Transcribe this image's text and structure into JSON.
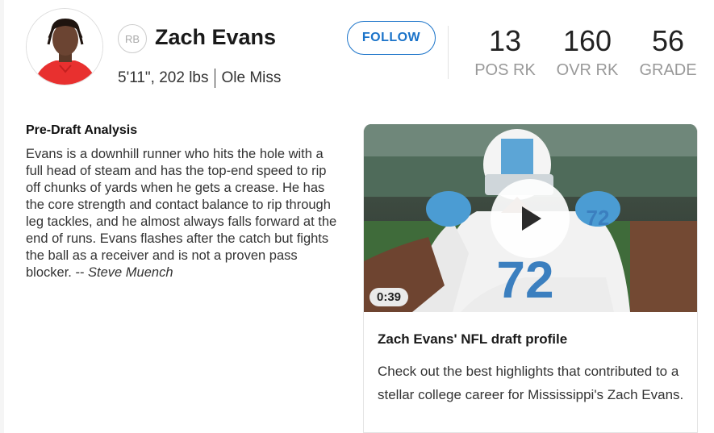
{
  "player": {
    "position": "RB",
    "name": "Zach Evans",
    "measurables": "5'11\", 202 lbs",
    "school": "Ole Miss"
  },
  "follow_label": "FOLLOW",
  "stats": [
    {
      "value": "13",
      "label": "POS RK"
    },
    {
      "value": "160",
      "label": "OVR RK"
    },
    {
      "value": "56",
      "label": "GRADE"
    }
  ],
  "analysis": {
    "title": "Pre-Draft Analysis",
    "body": "Evans is a downhill runner who hits the hole with a full head of steam and has the top-end speed to rip off chunks of yards when he gets a crease. He has the core strength and contact balance to rip through leg tackles, and he almost always falls forward at the end of runs. Evans flashes after the catch but fights the ball as a receiver and is not a proven pass blocker. -- ",
    "author": "Steve Muench"
  },
  "video": {
    "duration": "0:39",
    "title": "Zach Evans' NFL draft profile",
    "description": "Check out the best highlights that contributed to a stellar college career for Mississippi's Zach Evans.",
    "jersey_number": "72"
  },
  "colors": {
    "accent": "#1a73c9",
    "jersey": "#4b9cd3",
    "headshot_shirt": "#e8302f"
  },
  "icons": {
    "play": "play-icon",
    "avatar": "player-headshot"
  }
}
